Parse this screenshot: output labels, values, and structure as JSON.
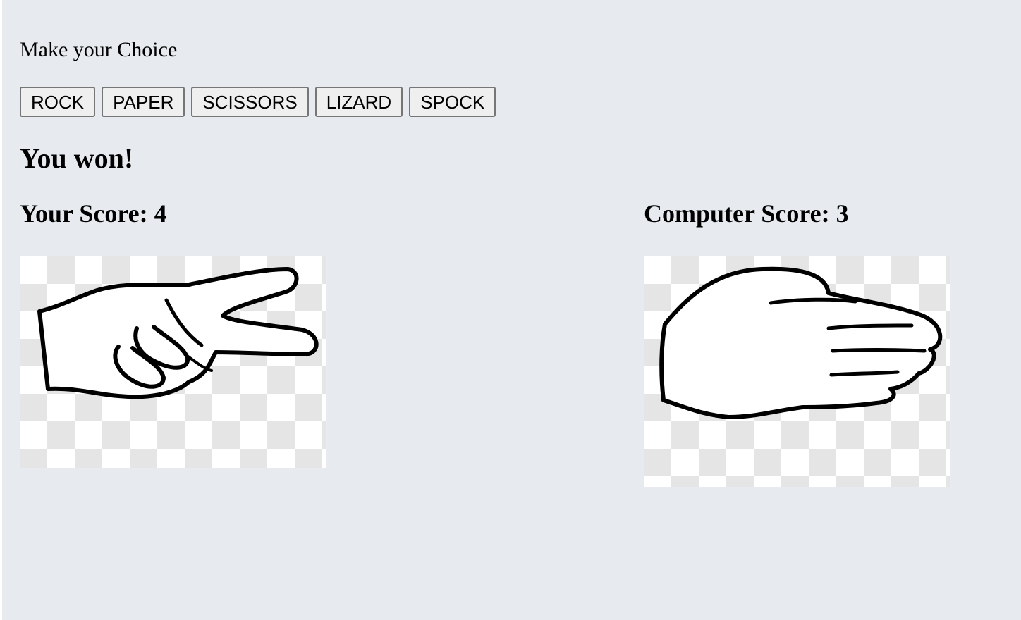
{
  "prompt": "Make your Choice",
  "choices": {
    "rock": "ROCK",
    "paper": "PAPER",
    "scissors": "SCISSORS",
    "lizard": "LIZARD",
    "spock": "SPOCK"
  },
  "result": "You won!",
  "scores": {
    "player": "Your Score: 4",
    "computer": "Computer Score: 3"
  },
  "images": {
    "player_hand": "scissors-hand",
    "computer_hand": "paper-hand"
  }
}
